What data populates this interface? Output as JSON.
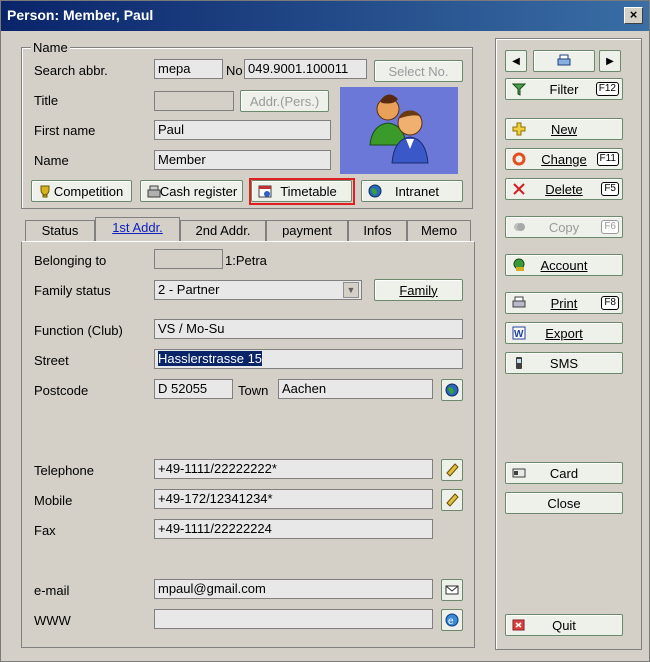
{
  "window": {
    "title": "Person: Member, Paul",
    "close": "×"
  },
  "name_group": {
    "legend": "Name",
    "search_abbr_label": "Search abbr.",
    "search_abbr_value": "mepa",
    "no_label": "No",
    "no_value": "049.9001.100011",
    "select_no_button": "Select No.",
    "title_label": "Title",
    "title_value": "",
    "addr_pers_button": "Addr.(Pers.)",
    "first_name_label": "First name",
    "first_name_value": "Paul",
    "name_label": "Name",
    "name_value": "Member",
    "competition_button": "Competition",
    "cash_register_button": "Cash register",
    "timetable_button": "Timetable",
    "intranet_button": "Intranet"
  },
  "tabs": [
    "Status",
    "1st Addr.",
    "2nd Addr.",
    "payment",
    "Infos",
    "Memo"
  ],
  "address": {
    "belonging_label": "Belonging to",
    "belonging_value": "",
    "belonging_text": "1:Petra",
    "family_status_label": "Family status",
    "family_status_value": "2 - Partner",
    "family_button": "Family",
    "function_label": "Function (Club)",
    "function_value": "VS / Mo-Su",
    "street_label": "Street",
    "street_value": "Hasslerstrasse 15",
    "postcode_label": "Postcode",
    "postcode_value": "D 52055",
    "town_label": "Town",
    "town_value": "Aachen",
    "telephone_label": "Telephone",
    "telephone_value": "+49-1111/22222222*",
    "mobile_label": "Mobile",
    "mobile_value": "+49-172/12341234*",
    "fax_label": "Fax",
    "fax_value": "+49-1111/22222224",
    "email_label": "e-mail",
    "email_value": "mpaul@gmail.com",
    "www_label": "WWW",
    "www_value": ""
  },
  "side": {
    "filter": "Filter",
    "filter_key": "F12",
    "new": "New",
    "change": "Change",
    "change_key": "F11",
    "delete": "Delete",
    "delete_key": "F5",
    "copy": "Copy",
    "copy_key": "F6",
    "account": "Account",
    "print": "Print",
    "print_key": "F8",
    "export": "Export",
    "sms": "SMS",
    "card": "Card",
    "close": "Close",
    "quit": "Quit"
  }
}
